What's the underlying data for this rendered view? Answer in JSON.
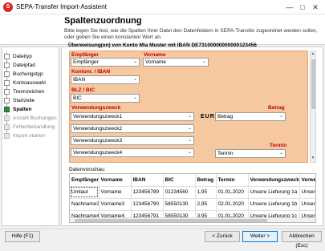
{
  "window": {
    "title": "SEPA-Transfer Import-Assistent",
    "icon": "app-logo-icon",
    "controls": [
      "minimize-icon",
      "maximize-icon",
      "close-icon"
    ]
  },
  "header": {
    "title": "Spaltenzuordnung",
    "description": "Bitte legen Sie fest, wie die Spalten Ihrer Datei den Datenfeldern in SEPA-Transfer zugeordnet werden sollen, oder geben Sie einen konstanten Wert an."
  },
  "steps": [
    {
      "label": "Dateityp",
      "state": "done"
    },
    {
      "label": "Dateipfad",
      "state": "done"
    },
    {
      "label": "Buchungstyp",
      "state": "done"
    },
    {
      "label": "Kontoauswahl",
      "state": "done"
    },
    {
      "label": "Trennzeichen",
      "state": "done"
    },
    {
      "label": "Startzeile",
      "state": "done"
    },
    {
      "label": "Spalten",
      "state": "active"
    },
    {
      "label": "Anzahl Buchungen",
      "state": "pending"
    },
    {
      "label": "Fehlerbehandlung",
      "state": "pending"
    },
    {
      "label": "Import starten",
      "state": "pending"
    }
  ],
  "mapping": {
    "account_title": "Überweisung(en) von Konto Mia Muster mit IBAN DE73100000000000123456",
    "empfaenger_label": "Empfänger",
    "vorname_label": "Vorname",
    "empfaenger_value": "Empfänger",
    "vorname_value": "Vorname",
    "konto_label": "Kontonr. / IBAN",
    "konto_value": "IBAN",
    "blz_label": "BLZ / BIC",
    "blz_value": "BIC",
    "zweck_label": "Verwendungszweck",
    "betrag_label": "Betrag",
    "zweck1": "Verwendungszweck1",
    "zweck2": "Verwendungszweck2",
    "zweck3": "Verwendungszweck3",
    "zweck4": "Verwendungszweck4",
    "currency": "EUR",
    "betrag_value": "Betrag",
    "termin_label": "Termin",
    "termin_value": "Termin",
    "accent_color": "#c00000",
    "panel_color": "#f5c8a0"
  },
  "preview": {
    "label": "Datenvorschau:",
    "columns": [
      "Empfänger",
      "Vorname",
      "IBAN",
      "BIC",
      "Betrag",
      "Termin",
      "Verwendungszweck",
      "Verwendun"
    ],
    "rows": [
      [
        "Umlaut",
        "Vorname",
        "123456789",
        "01234560",
        "1,95",
        "01.01.2020",
        "Unsere Lieferung 1a",
        "Unsere Liefer"
      ],
      [
        "Nachname3",
        "Vorname3",
        "123456790",
        "58550130",
        "2,95",
        "02.01.2020",
        "Unsere Lieferung 1b",
        "Unsere Liefer"
      ],
      [
        "Nachname4",
        "Vorname4",
        "123456791",
        "58550130",
        "3,95",
        "01.01.2020",
        "Unsere Lieferung 1c",
        "Unsere Liefer"
      ]
    ]
  },
  "footer": {
    "help": "Hilfe (F1)",
    "back": "< Zurück",
    "next": "Weiter >",
    "cancel": "Abbrechen (Esc)"
  }
}
